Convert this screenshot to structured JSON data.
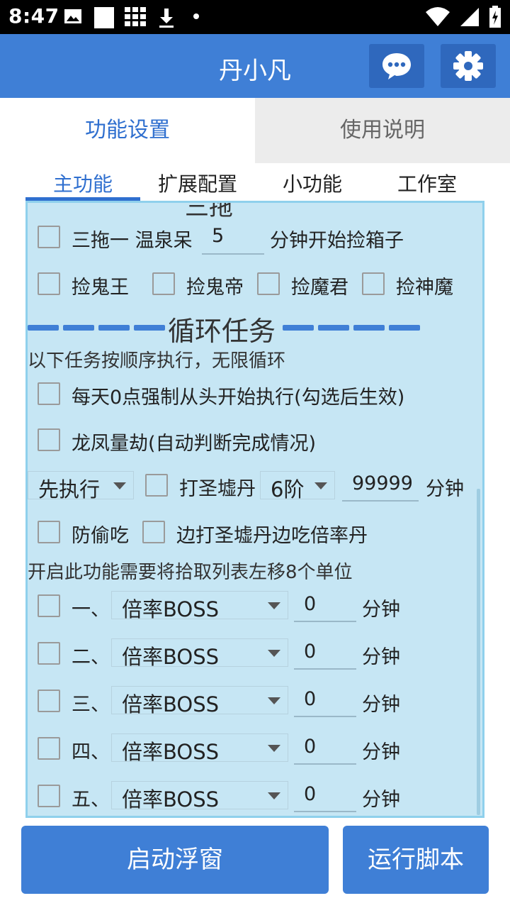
{
  "status_bar": {
    "time": "8:47"
  },
  "app_bar": {
    "title": "丹小凡"
  },
  "top_tabs": [
    {
      "label": "功能设置"
    },
    {
      "label": "使用说明"
    }
  ],
  "sub_tabs": [
    {
      "label": "主功能"
    },
    {
      "label": "扩展配置"
    },
    {
      "label": "小功能"
    },
    {
      "label": "工作室"
    }
  ],
  "panel": {
    "cut_heading": "三拖",
    "santuo": {
      "label": "三拖一 温泉呆",
      "minutes": "5",
      "suffix": "分钟开始捡箱子"
    },
    "pick": [
      "捡鬼王",
      "捡鬼帝",
      "捡魔君",
      "捡神魔"
    ],
    "loop_title": "循环任务",
    "loop_desc": "以下任务按顺序执行，无限循环",
    "daily_reset": "每天0点强制从头开始执行(勾选后生效)",
    "longfeng": "龙凤量劫(自动判断完成情况)",
    "exec_mode": "先执行",
    "shengxu_label": "打圣墟丹",
    "shengxu_level": "6阶",
    "shengxu_minutes": "99999",
    "minute_unit": "分钟",
    "anti_steal": "防偷吃",
    "eat_rate": "边打圣墟丹边吃倍率丹",
    "notice": "开启此功能需要将拾取列表左移8个单位",
    "boss_rows": [
      {
        "label": "一、",
        "select": "倍率BOSS",
        "minutes": "0"
      },
      {
        "label": "二、",
        "select": "倍率BOSS",
        "minutes": "0"
      },
      {
        "label": "三、",
        "select": "倍率BOSS",
        "minutes": "0"
      },
      {
        "label": "四、",
        "select": "倍率BOSS",
        "minutes": "0"
      },
      {
        "label": "五、",
        "select": "倍率BOSS",
        "minutes": "0"
      }
    ]
  },
  "buttons": {
    "float": "启动浮窗",
    "run": "运行脚本"
  },
  "colors": {
    "primary": "#3f7fd6",
    "panel_bg": "#c6e6f4",
    "accent_text": "#2f6fcf"
  },
  "icons": {
    "message": "message-icon",
    "settings": "gear-icon"
  }
}
